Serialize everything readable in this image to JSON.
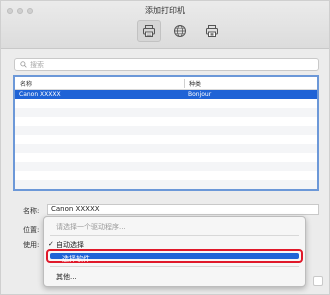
{
  "window": {
    "title": "添加打印机"
  },
  "toolbar": [
    {
      "name": "default-printer",
      "icon": "printer-icon",
      "active": true
    },
    {
      "name": "ip-printer",
      "icon": "globe-icon",
      "active": false
    },
    {
      "name": "windows-printer",
      "icon": "windows-printer-icon",
      "active": false
    }
  ],
  "search": {
    "placeholder": "搜索"
  },
  "list": {
    "headers": {
      "name": "名称",
      "kind": "种类"
    },
    "rows": [
      {
        "name": "Canon XXXXX",
        "kind": "Bonjour",
        "selected": true
      }
    ]
  },
  "form": {
    "name_label": "名称:",
    "name_value": "Canon XXXXX",
    "location_label": "位置:",
    "use_label": "使用:"
  },
  "dropdown": {
    "placeholder": "请选择一个驱动程序...",
    "auto_select": "自动选择",
    "select_software": "选择软件...",
    "other": "其他..."
  },
  "colors": {
    "selection": "#1f63d6",
    "highlight_border": "#e0192a",
    "list_border": "#6c98d8"
  }
}
